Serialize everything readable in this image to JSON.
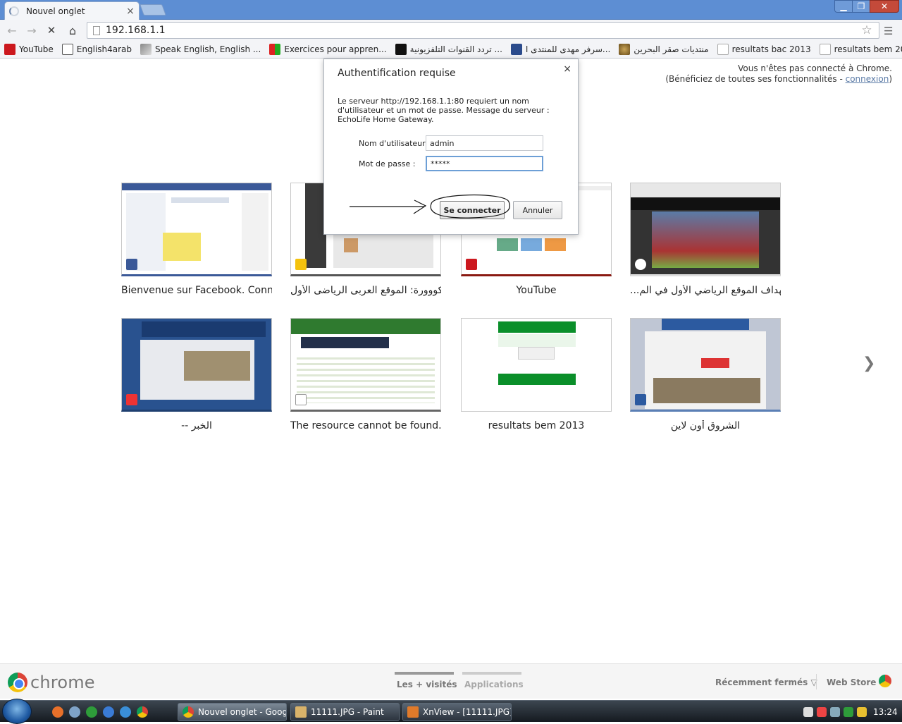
{
  "tab": {
    "title": "Nouvel onglet"
  },
  "window": {
    "minimize": "▁",
    "maximize": "❐",
    "close": "✕"
  },
  "omnibox": {
    "url": "192.168.1.1"
  },
  "bookmarks": [
    {
      "label": "YouTube",
      "icon": "youtube-icon"
    },
    {
      "label": "English4arab",
      "icon": "e-icon"
    },
    {
      "label": "Speak English, English ...",
      "icon": "speak-icon"
    },
    {
      "label": "Exercices pour appren...",
      "icon": "exercices-icon"
    },
    {
      "label": "تردد القنوات التلفزيونية ...",
      "icon": "tv-icon"
    },
    {
      "label": "سرفر مهدى للمنتدى ا...",
      "icon": "s-icon"
    },
    {
      "label": "منتديات صقر البحرين",
      "icon": "saqr-icon"
    },
    {
      "label": "resultats bac 2013",
      "icon": "page-icon"
    },
    {
      "label": "resultats bem 2013",
      "icon": "page-icon"
    }
  ],
  "signin": {
    "line1": "Vous n'êtes pas connecté à Chrome.",
    "line2_prefix": "(Bénéficiez de toutes ses fonctionnalités - ",
    "link": "connexion",
    "line2_suffix": ")"
  },
  "tiles": [
    {
      "title": "Bienvenue sur Facebook. Conne...",
      "icon": "facebook-icon"
    },
    {
      "title": "كووورة: الموقع العربى الرياضى الأول",
      "icon": "kooora-icon"
    },
    {
      "title": "YouTube",
      "icon": "youtube-icon"
    },
    {
      "title": "...الهداف الموقع الرياضي الأول في الم",
      "icon": "football-icon"
    },
    {
      "title": "-- الخبر",
      "icon": "elkhabar-icon"
    },
    {
      "title": "The resource cannot be found.",
      "icon": "page-icon"
    },
    {
      "title": "resultats bem 2013",
      "icon": "page-icon"
    },
    {
      "title": "الشروق أون لاين",
      "icon": "echorouk-icon"
    }
  ],
  "dialog": {
    "title": "Authentification requise",
    "message": "Le serveur http://192.168.1.1:80 requiert un nom d'utilisateur et un mot de passe. Message du serveur : EchoLife Home Gateway.",
    "username_label": "Nom d'utilisateur :",
    "username_value": "admin",
    "password_label": "Mot de passe :",
    "password_value": "*****",
    "login_button": "Se connecter",
    "cancel_button": "Annuler",
    "close": "×"
  },
  "footer": {
    "brand": "chrome",
    "tab_most_visited": "Les + visités",
    "tab_apps": "Applications",
    "recently_closed": "Récemment fermés ▽",
    "web_store": "Web Store"
  },
  "taskbar": {
    "tasks": [
      {
        "label": "Nouvel onglet - Googl...",
        "icon": "chrome-icon"
      },
      {
        "label": "11111.JPG - Paint",
        "icon": "paint-icon"
      },
      {
        "label": "XnView - [11111.JPG]",
        "icon": "xnview-icon"
      }
    ],
    "clock": "13:24"
  },
  "next_arrow": "❯",
  "colors": {
    "titlebar": "#5d8ed3",
    "link": "#5a7aa6",
    "dialog_focus": "#6d9fd6"
  }
}
